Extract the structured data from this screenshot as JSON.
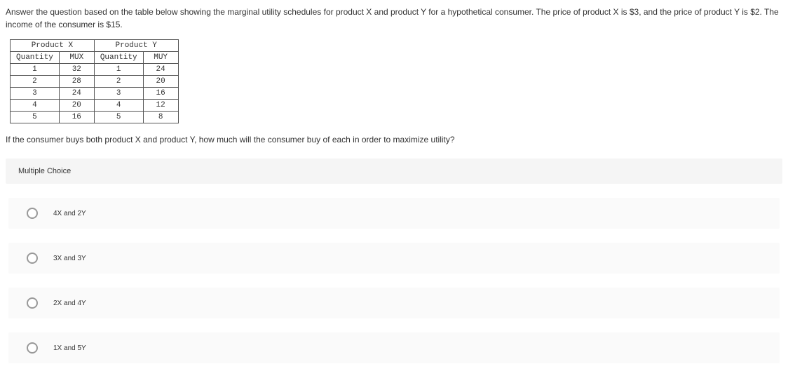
{
  "question": {
    "intro": "Answer the question based on the table below showing the marginal utility schedules for product X and product Y for a hypothetical consumer. The price of product X is $3, and the price of product Y is $2. The income of the consumer is $15.",
    "sub_question": "If the consumer buys both product X and product Y, how much will the consumer buy of each in order to maximize utility?"
  },
  "table": {
    "product_x_header": "Product X",
    "product_y_header": "Product Y",
    "col_qty": "Quantity",
    "col_mux": "MUX",
    "col_muy": "MUY",
    "rows": [
      {
        "qx": "1",
        "mux": "32",
        "qy": "1",
        "muy": "24"
      },
      {
        "qx": "2",
        "mux": "28",
        "qy": "2",
        "muy": "20"
      },
      {
        "qx": "3",
        "mux": "24",
        "qy": "3",
        "muy": "16"
      },
      {
        "qx": "4",
        "mux": "20",
        "qy": "4",
        "muy": "12"
      },
      {
        "qx": "5",
        "mux": "16",
        "qy": "5",
        "muy": "8"
      }
    ]
  },
  "section_label": "Multiple Choice",
  "choices": [
    {
      "label": "4X and 2Y"
    },
    {
      "label": "3X and 3Y"
    },
    {
      "label": "2X and 4Y"
    },
    {
      "label": "1X and 5Y"
    }
  ]
}
